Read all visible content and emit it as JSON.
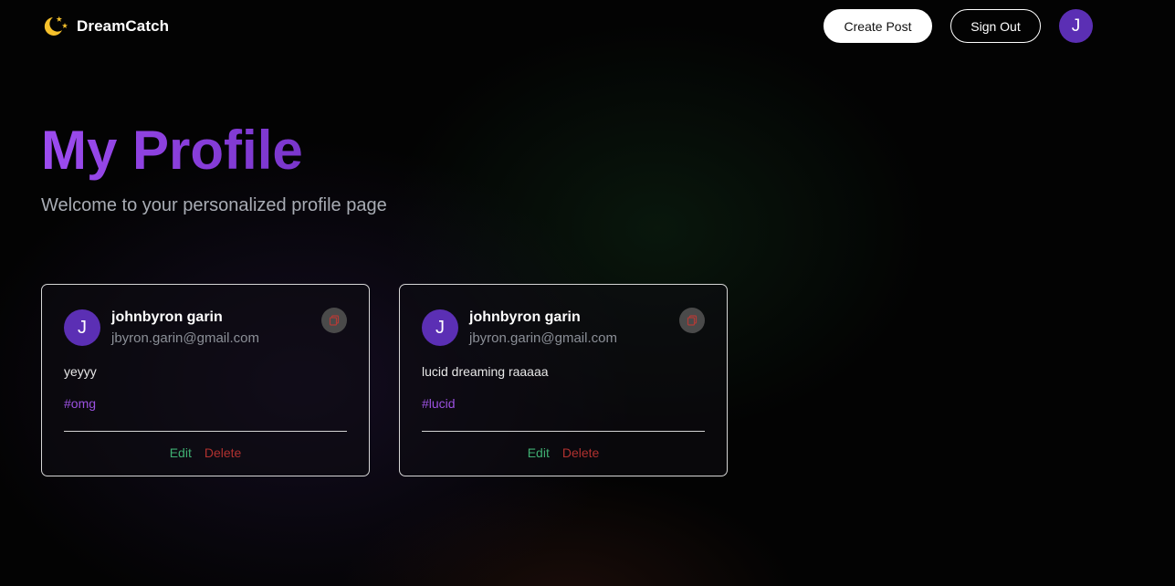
{
  "header": {
    "brand": "DreamCatch",
    "logo_icon": "moon-stars-icon",
    "create_post_label": "Create Post",
    "sign_out_label": "Sign Out",
    "avatar_initial": "J"
  },
  "hero": {
    "title": "My Profile",
    "subtitle": "Welcome to your personalized profile page"
  },
  "posts": [
    {
      "avatar_initial": "J",
      "name": "johnbyron garin",
      "email": "jbyron.garin@gmail.com",
      "copy_icon": "copy-icon",
      "text": "yeyyy",
      "tag": "#omg",
      "edit_label": "Edit",
      "delete_label": "Delete"
    },
    {
      "avatar_initial": "J",
      "name": "johnbyron garin",
      "email": "jbyron.garin@gmail.com",
      "copy_icon": "copy-icon",
      "text": "lucid dreaming raaaaa",
      "tag": "#lucid",
      "edit_label": "Edit",
      "delete_label": "Delete"
    }
  ],
  "colors": {
    "accent_purple": "#9d4cf0",
    "avatar_bg": "#5b2fb4",
    "edit_green": "#3fae72",
    "delete_red": "#b0312f"
  }
}
